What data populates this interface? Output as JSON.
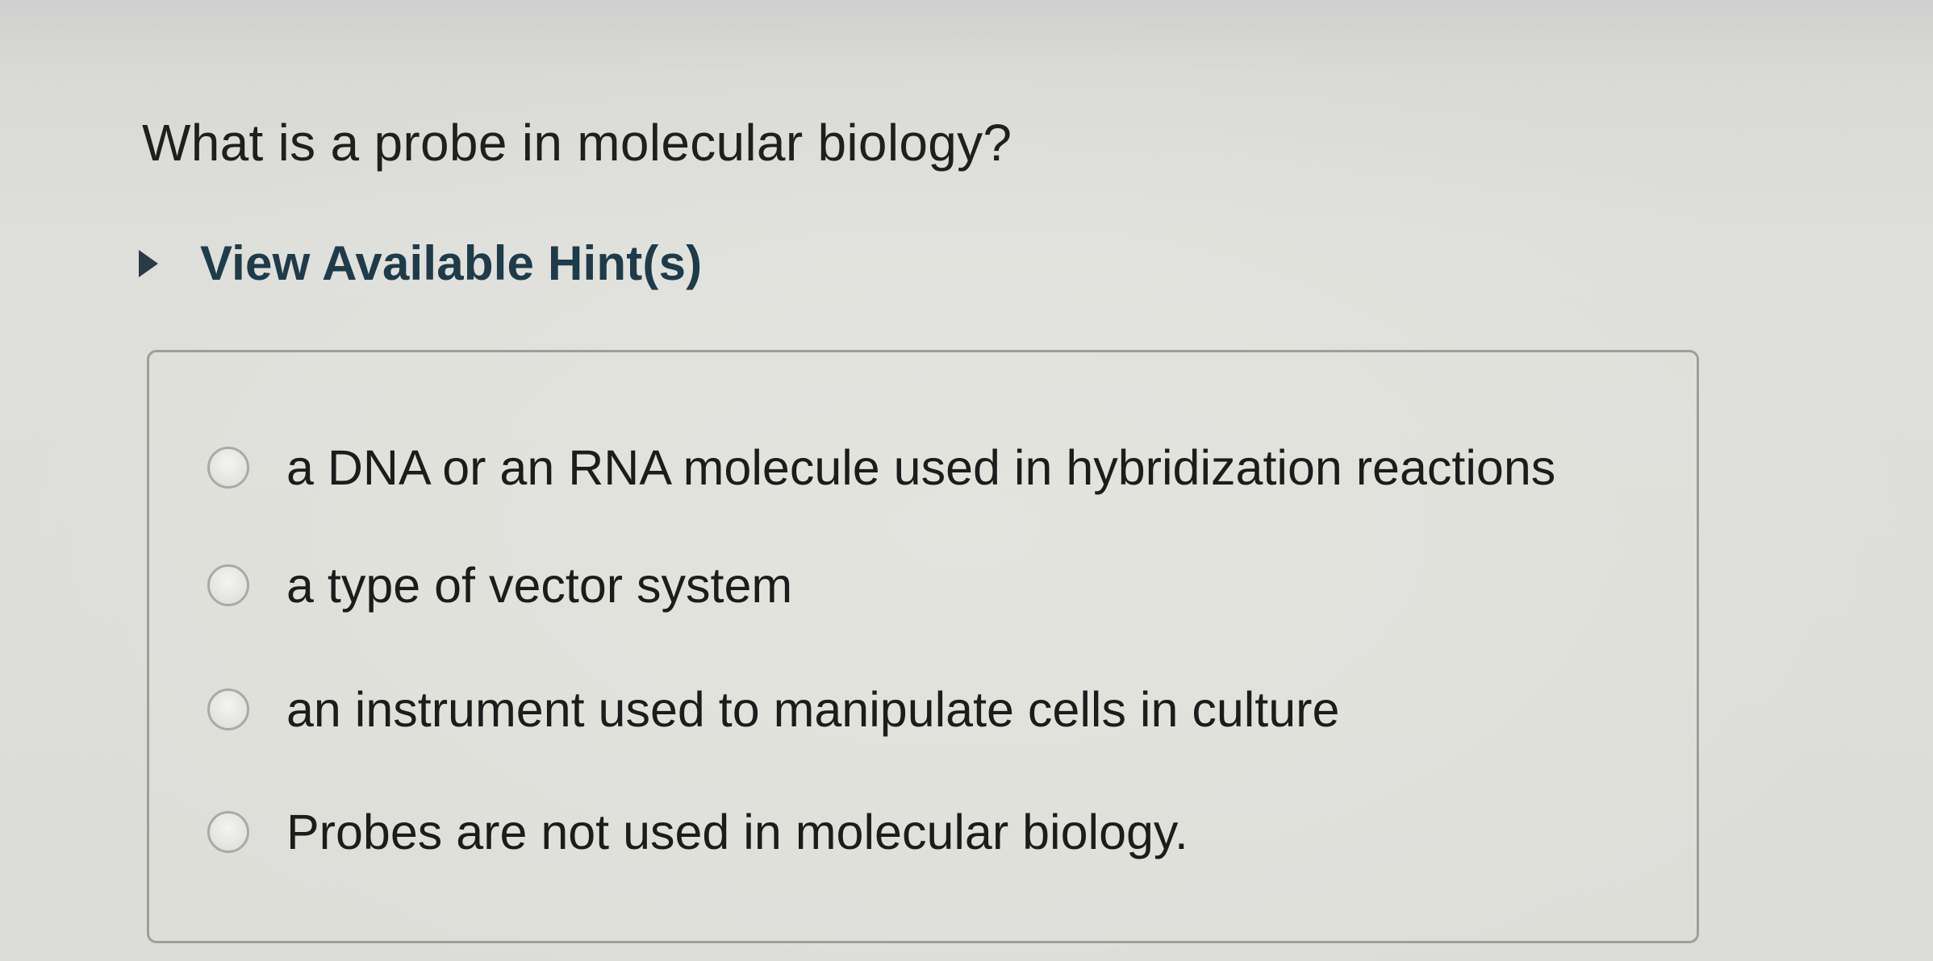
{
  "question": {
    "text": "What is a probe in molecular biology?"
  },
  "hint": {
    "label": "View Available Hint(s)"
  },
  "choices": [
    {
      "label": "a DNA or an RNA molecule used in hybridization reactions"
    },
    {
      "label": "a type of vector system"
    },
    {
      "label": "an instrument used to manipulate cells in culture"
    },
    {
      "label": "Probes are not used in molecular biology."
    }
  ]
}
